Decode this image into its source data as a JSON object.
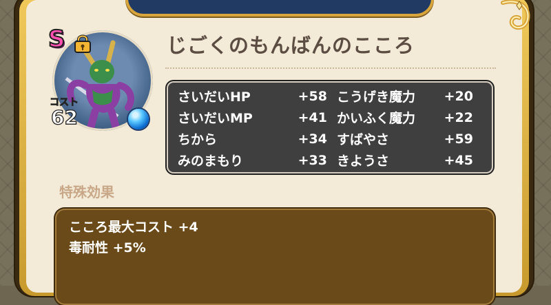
{
  "card": {
    "name": "じごくのもんばんのこころ",
    "rank": "S",
    "cost_label": "コスト",
    "cost_value": "62"
  },
  "stats": [
    {
      "left_label": "さいだいHP",
      "left_value": "+58",
      "right_label": "こうげき魔力",
      "right_value": "+20"
    },
    {
      "left_label": "さいだいMP",
      "left_value": "+41",
      "right_label": "かいふく魔力",
      "right_value": "+22"
    },
    {
      "left_label": "ちから",
      "left_value": "+34",
      "right_label": "すばやさ",
      "right_value": "+59"
    },
    {
      "left_label": "みのまもり",
      "left_value": "+33",
      "right_label": "きようさ",
      "right_value": "+45"
    }
  ],
  "special": {
    "heading": "特殊効果",
    "lines": [
      "こころ最大コスト +4",
      "毒耐性 +5%"
    ]
  },
  "colors": {
    "rank_s": "#ff4fb0",
    "panel": "#f3ead7",
    "stats_bg": "#3f3f3f",
    "special_bg": "#6b4a19",
    "gold": "#d7a53b"
  },
  "icons": [
    "lock-icon",
    "blue-orb-icon",
    "monster-portrait"
  ]
}
